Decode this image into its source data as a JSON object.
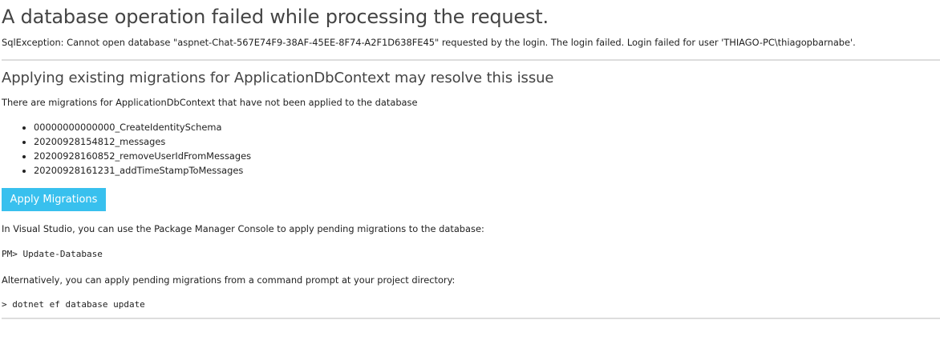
{
  "error": {
    "title": "A database operation failed while processing the request.",
    "detail": "SqlException: Cannot open database \"aspnet-Chat-567E74F9-38AF-45EE-8F74-A2F1D638FE45\" requested by the login. The login failed. Login failed for user 'THIAGO-PC\\thiagopbarnabe'."
  },
  "migrations": {
    "heading": "Applying existing migrations for ApplicationDbContext may resolve this issue",
    "intro": "There are migrations for ApplicationDbContext that have not been applied to the database",
    "items": [
      "00000000000000_CreateIdentitySchema",
      "20200928154812_messages",
      "20200928160852_removeUserIdFromMessages",
      "20200928161231_addTimeStampToMessages"
    ],
    "apply_button_label": "Apply Migrations",
    "button_color": "#38c0ee"
  },
  "instructions": {
    "visual_studio_text": "In Visual Studio, you can use the Package Manager Console to apply pending migrations to the database:",
    "pm_command": "PM> Update-Database",
    "alternative_text": "Alternatively, you can apply pending migrations from a command prompt at your project directory:",
    "cli_command": "> dotnet ef database update"
  }
}
